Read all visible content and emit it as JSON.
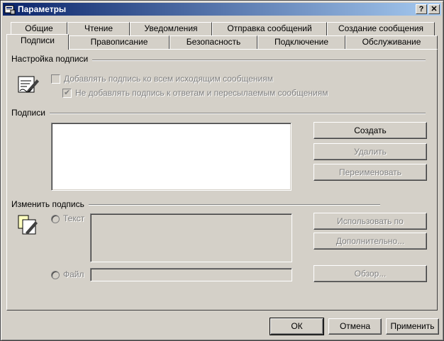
{
  "window": {
    "title": "Параметры",
    "help_btn": "?",
    "close_btn": "✕"
  },
  "tabs_row1": [
    "Общие",
    "Чтение",
    "Уведомления",
    "Отправка сообщений",
    "Создание сообщения"
  ],
  "tabs_row2": [
    "Подписи",
    "Правописание",
    "Безопасность",
    "Подключение",
    "Обслуживание"
  ],
  "active_tab": "Подписи",
  "signature_settings": {
    "group_label": "Настройка подписи",
    "add_to_all": "Добавлять подпись ко всем исходящим сообщениям",
    "add_to_all_checked": false,
    "no_replies": "Не добавлять подпись к ответам и пересылаемым сообщениям",
    "no_replies_checked": true
  },
  "signatures": {
    "group_label": "Подписи",
    "create": "Создать",
    "delete": "Удалить",
    "rename": "Переименовать"
  },
  "edit_signature": {
    "group_label": "Изменить подпись",
    "text_label": "Текст",
    "file_label": "Файл",
    "set_default": "Использовать по умолчанию",
    "advanced": "Дополнительно...",
    "browse": "Обзор..."
  },
  "footer": {
    "ok": "ОК",
    "cancel": "Отмена",
    "apply": "Применить"
  },
  "colors": {
    "face": "#d4d0c8",
    "title_start": "#0a246a",
    "title_end": "#a6caf0",
    "disabled_text": "#808080"
  }
}
